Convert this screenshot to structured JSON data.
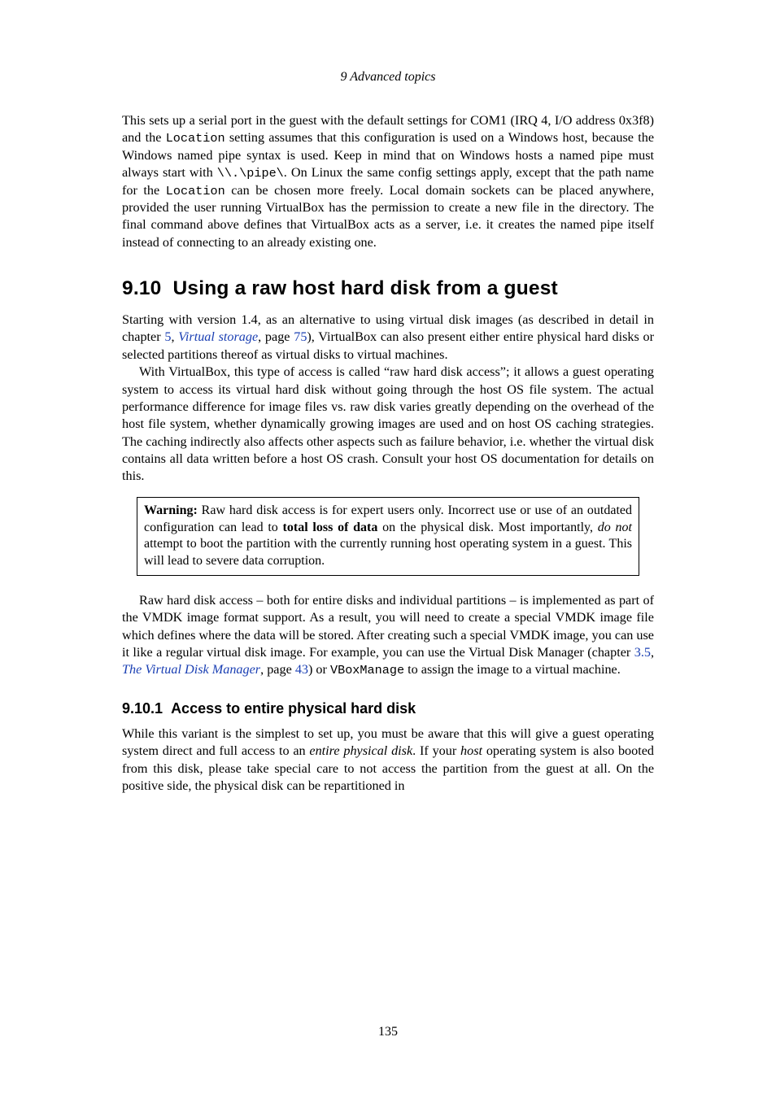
{
  "running_head": "9 Advanced topics",
  "para1": {
    "t1": "This sets up a serial port in the guest with the default settings for COM1 (IRQ 4, I/O address 0x3f8) and the ",
    "c1": "Location",
    "t2": " setting assumes that this configuration is used on a Windows host, because the Windows named pipe syntax is used. Keep in mind that on Windows hosts a named pipe must always start with ",
    "c2": "\\\\.\\pipe\\",
    "t3": ". On Linux the same config settings apply, except that the path name for the ",
    "c3": "Location",
    "t4": " can be chosen more freely. Local domain sockets can be placed anywhere, provided the user running VirtualBox has the permission to create a new file in the directory. The final command above defines that VirtualBox acts as a server, i.e. it creates the named pipe itself instead of connecting to an already existing one."
  },
  "sec": {
    "num": "9.10",
    "title": "Using a raw host hard disk from a guest"
  },
  "para2": {
    "t1": "Starting with version 1.4, as an alternative to using virtual disk images (as described in detail in chapter ",
    "l1": "5",
    "t2": ", ",
    "l2": "Virtual storage",
    "t3": ", page ",
    "l3": "75",
    "t4": "), VirtualBox can also present either entire physical hard disks or selected partitions thereof as virtual disks to virtual machines."
  },
  "para3": "With VirtualBox, this type of access is called “raw hard disk access”; it allows a guest operating system to access its virtual hard disk without going through the host OS file system. The actual performance difference for image files vs. raw disk varies greatly depending on the overhead of the host file system, whether dynamically growing images are used and on host OS caching strategies. The caching indirectly also affects other aspects such as failure behavior, i.e. whether the virtual disk contains all data written before a host OS crash. Consult your host OS documentation for details on this.",
  "warning": {
    "label": "Warning:",
    "t1": " Raw hard disk access is for expert users only. Incorrect use or use of an outdated configuration can lead to ",
    "b1": "total loss of data",
    "t2": " on the physical disk. Most importantly, ",
    "i1": "do not",
    "t3": " attempt to boot the partition with the currently running host operating system in a guest. This will lead to severe data corruption."
  },
  "para4": {
    "t1": "Raw hard disk access – both for entire disks and individual partitions – is implemented as part of the VMDK image format support. As a result, you will need to create a special VMDK image file which defines where the data will be stored. After creating such a special VMDK image, you can use it like a regular virtual disk image. For example, you can use the Virtual Disk Manager (chapter ",
    "l1": "3.5",
    "t2": ", ",
    "l2": "The Virtual Disk Manager",
    "t3": ", page ",
    "l3": "43",
    "t4": ") or ",
    "c1": "VBoxManage",
    "t5": " to assign the image to a virtual machine."
  },
  "subsec": {
    "num": "9.10.1",
    "title": "Access to entire physical hard disk"
  },
  "para5": {
    "t1": "While this variant is the simplest to set up, you must be aware that this will give a guest operating system direct and full access to an ",
    "i1": "entire physical disk",
    "t2": ". If your ",
    "i2": "host",
    "t3": " operating system is also booted from this disk, please take special care to not access the partition from the guest at all. On the positive side, the physical disk can be repartitioned in"
  },
  "page_number": "135"
}
